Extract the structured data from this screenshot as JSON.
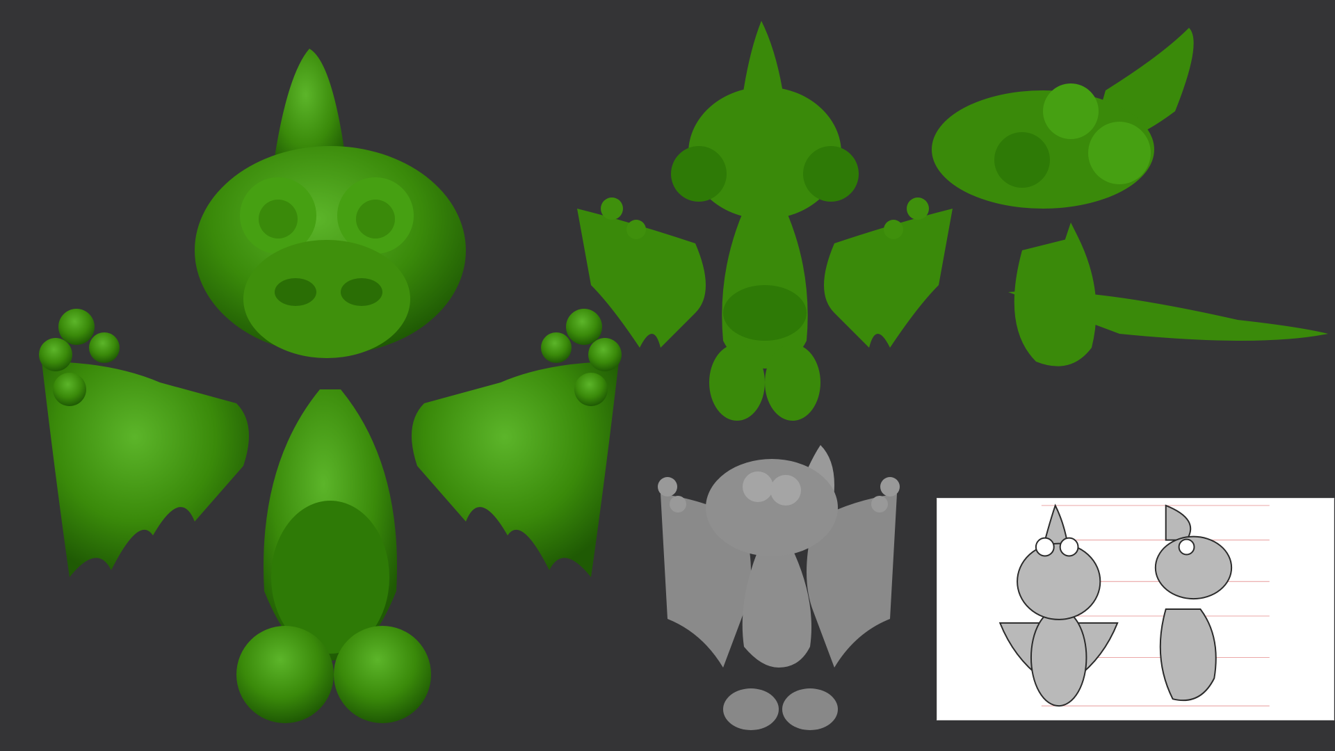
{
  "scene": {
    "background_color": "#343436",
    "model_color": "#3a8a0a",
    "model_highlight": "#5cb52a",
    "model_shadow": "#1f5a04",
    "preview_color": "#8a8a8a",
    "reference_background": "#ffffff"
  },
  "views": [
    {
      "name": "front-view",
      "description_icon": "dinosaur-front-render"
    },
    {
      "name": "front-small-view",
      "description_icon": "dinosaur-front-render"
    },
    {
      "name": "side-view",
      "description_icon": "dinosaur-side-render"
    },
    {
      "name": "grey-preview-view",
      "description_icon": "dinosaur-grey-render"
    },
    {
      "name": "reference-sheet",
      "description_icon": "dinosaur-sketch-turnaround"
    }
  ]
}
